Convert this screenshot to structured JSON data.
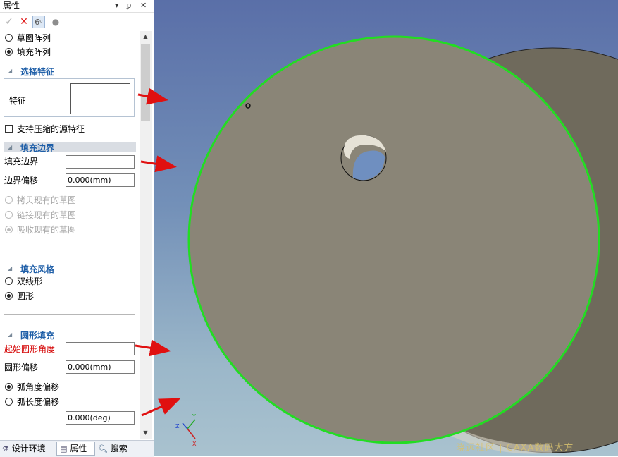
{
  "panel": {
    "title": "属性",
    "title_controls": [
      "▾",
      "ᵱ",
      "✕"
    ],
    "toolbar": {
      "ok_icon": "check-icon",
      "cancel_icon": "x-icon",
      "preview_icon": "glasses-icon",
      "pin_icon": "dot-icon"
    },
    "pattern_type": {
      "options": [
        "草图阵列",
        "填充阵列"
      ],
      "selected": "填充阵列"
    },
    "select_feature": {
      "heading": "选择特征",
      "feature_label": "特征",
      "support_compressed_label": "支持压缩的源特征"
    },
    "fill_boundary": {
      "heading": "填充边界",
      "boundary_label": "填充边界",
      "boundary_value": "",
      "offset_label": "边界偏移",
      "offset_value": "0.000(mm)",
      "sketch_options": [
        "拷贝现有的草图",
        "链接现有的草图",
        "吸收现有的草图"
      ],
      "sketch_selected": "吸收现有的草图"
    },
    "fill_style": {
      "heading": "填充风格",
      "options": [
        "双线形",
        "圆形"
      ],
      "selected": "圆形"
    },
    "circle_fill": {
      "heading": "圆形填充",
      "start_angle_label": "起始圆形角度",
      "start_angle_value": "",
      "circle_offset_label": "圆形偏移",
      "circle_offset_value": "0.000(mm)",
      "offset_modes": [
        "弧角度偏移",
        "弧长度偏移"
      ],
      "offset_mode_selected": "弧角度偏移",
      "angle_value": "0.000(deg)"
    }
  },
  "tabs": [
    {
      "label": "设计环境",
      "icon": "design-env-icon"
    },
    {
      "label": "属性",
      "icon": "properties-icon"
    },
    {
      "label": "搜索",
      "icon": "search-icon"
    }
  ],
  "viewport": {
    "axis_labels": {
      "x": "X",
      "y": "Y",
      "z": "Z"
    },
    "watermark": "晓远社区 | CAXA数码大方"
  },
  "colors": {
    "section_heading": "#1f5fa8",
    "required_label": "#d40000",
    "selection_outline": "#22dd22",
    "annotation_arrow": "#e01010",
    "part_face": "#8a8577"
  }
}
